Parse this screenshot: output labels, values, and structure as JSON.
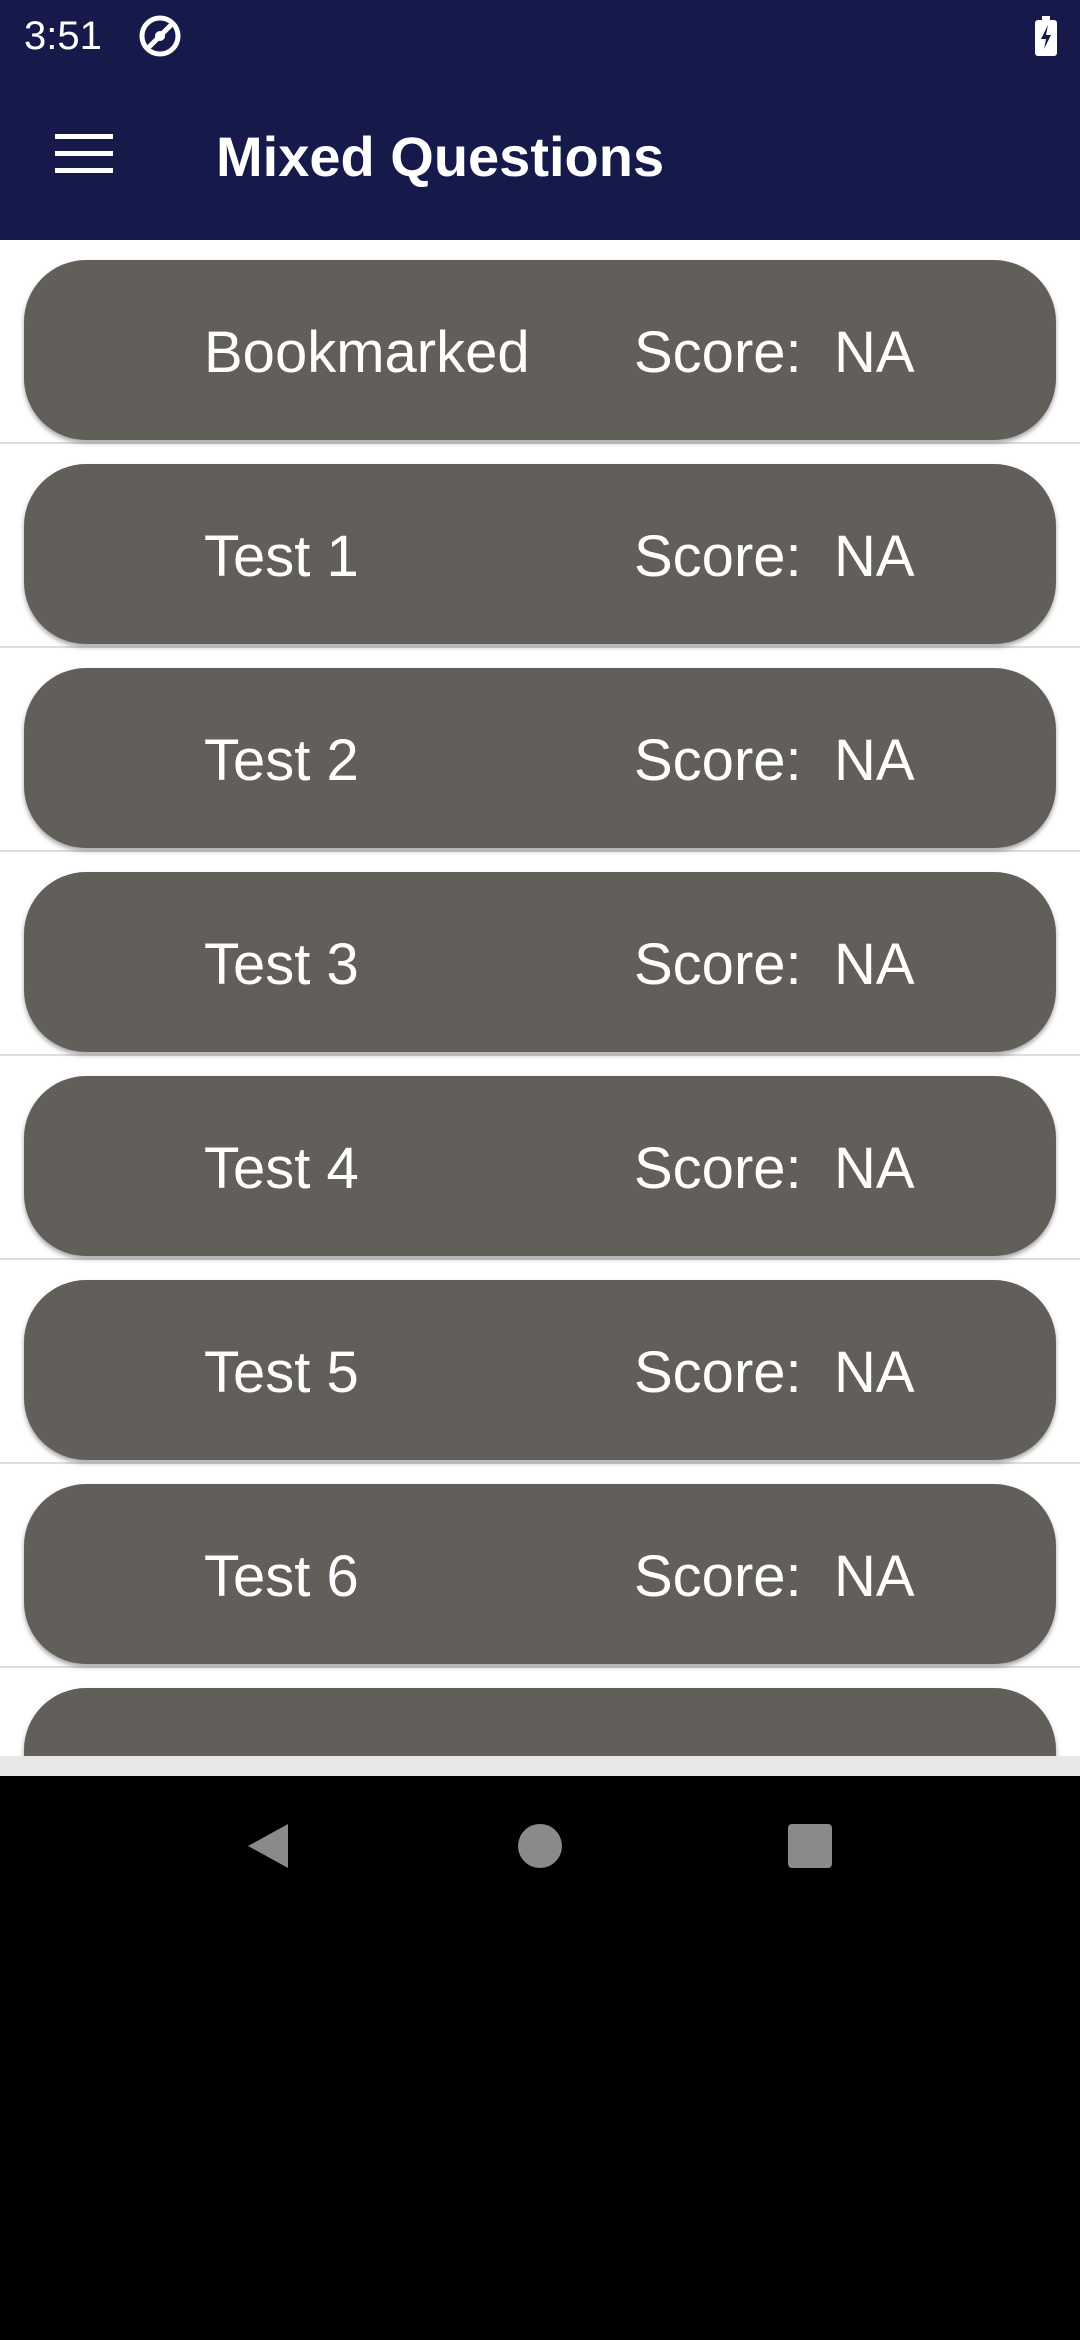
{
  "status_bar": {
    "time": "3:51",
    "app_icon": "circle-slash-icon",
    "battery_icon": "battery-charging-icon"
  },
  "app_bar": {
    "menu_icon": "hamburger-menu-icon",
    "title": "Mixed Questions"
  },
  "tests": [
    {
      "name": "Bookmarked",
      "score_label": "Score:",
      "score": "NA"
    },
    {
      "name": "Test 1",
      "score_label": "Score:",
      "score": "NA"
    },
    {
      "name": "Test 2",
      "score_label": "Score:",
      "score": "NA"
    },
    {
      "name": "Test 3",
      "score_label": "Score:",
      "score": "NA"
    },
    {
      "name": "Test 4",
      "score_label": "Score:",
      "score": "NA"
    },
    {
      "name": "Test 5",
      "score_label": "Score:",
      "score": "NA"
    },
    {
      "name": "Test 6",
      "score_label": "Score:",
      "score": "NA"
    }
  ],
  "nav_bar": {
    "back_icon": "back-triangle-icon",
    "home_icon": "home-circle-icon",
    "recents_icon": "recents-square-icon"
  },
  "colors": {
    "app_bar": "#151a4a",
    "card": "#625f5b",
    "text": "#ffffff"
  }
}
